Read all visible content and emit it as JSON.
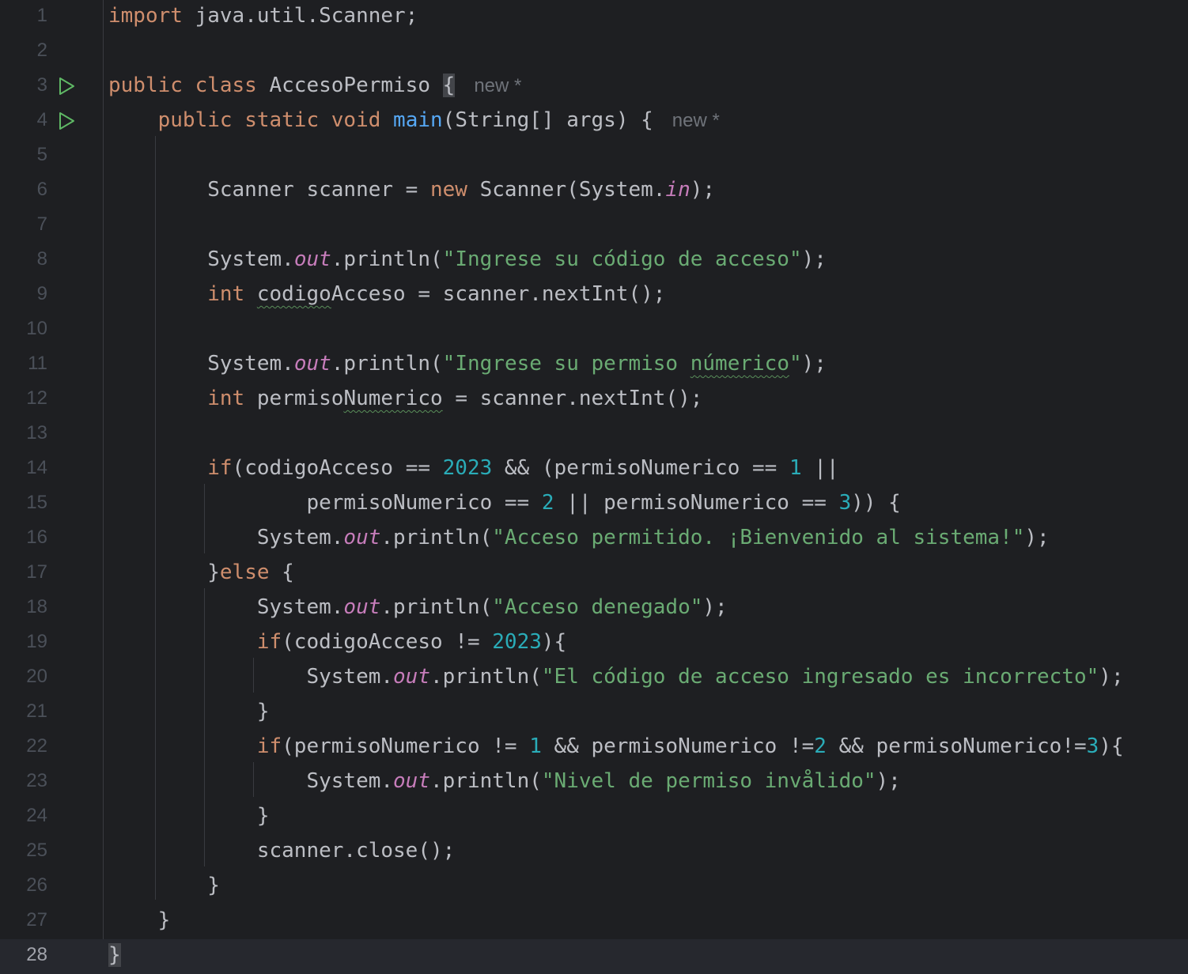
{
  "editor": {
    "current_line": 28,
    "inline_hint": "new *",
    "lines": [
      {
        "n": "1",
        "tokens": [
          {
            "t": "import",
            "c": "kw"
          },
          {
            "t": " java.util.Scanner;"
          }
        ]
      },
      {
        "n": "2",
        "tokens": []
      },
      {
        "n": "3",
        "run": true,
        "tokens": [
          {
            "t": "public class",
            "c": "kw"
          },
          {
            "t": " AccesoPermiso "
          },
          {
            "t": "{",
            "c": "brace-hl"
          }
        ],
        "hint": "new *"
      },
      {
        "n": "4",
        "run": true,
        "tokens": [
          {
            "t": "    "
          },
          {
            "t": "public static void",
            "c": "kw"
          },
          {
            "t": " "
          },
          {
            "t": "main",
            "c": "fn"
          },
          {
            "t": "(String[] args) {"
          }
        ],
        "hint": "new *"
      },
      {
        "n": "5",
        "tokens": []
      },
      {
        "n": "6",
        "tokens": [
          {
            "t": "        Scanner scanner = "
          },
          {
            "t": "new",
            "c": "kw"
          },
          {
            "t": " Scanner(System."
          },
          {
            "t": "in",
            "c": "st"
          },
          {
            "t": ");"
          }
        ]
      },
      {
        "n": "7",
        "tokens": []
      },
      {
        "n": "8",
        "tokens": [
          {
            "t": "        System."
          },
          {
            "t": "out",
            "c": "st"
          },
          {
            "t": ".println("
          },
          {
            "t": "\"Ingrese su código de acceso\"",
            "c": "str"
          },
          {
            "t": ");"
          }
        ]
      },
      {
        "n": "9",
        "tokens": [
          {
            "t": "        "
          },
          {
            "t": "int",
            "c": "kw"
          },
          {
            "t": " "
          },
          {
            "t": "codigo",
            "c": "wavy"
          },
          {
            "t": "Acceso = scanner.nextInt();"
          }
        ]
      },
      {
        "n": "10",
        "tokens": []
      },
      {
        "n": "11",
        "tokens": [
          {
            "t": "        System."
          },
          {
            "t": "out",
            "c": "st"
          },
          {
            "t": ".println("
          },
          {
            "t": "\"Ingrese su permiso ",
            "c": "str"
          },
          {
            "t": "númerico",
            "c": "str wavy"
          },
          {
            "t": "\"",
            "c": "str"
          },
          {
            "t": ");"
          }
        ]
      },
      {
        "n": "12",
        "tokens": [
          {
            "t": "        "
          },
          {
            "t": "int",
            "c": "kw"
          },
          {
            "t": " permiso"
          },
          {
            "t": "Numerico",
            "c": "wavy"
          },
          {
            "t": " = scanner.nextInt();"
          }
        ]
      },
      {
        "n": "13",
        "tokens": []
      },
      {
        "n": "14",
        "tokens": [
          {
            "t": "        "
          },
          {
            "t": "if",
            "c": "kw"
          },
          {
            "t": "(codigoAcceso == "
          },
          {
            "t": "2023",
            "c": "num"
          },
          {
            "t": " && (permisoNumerico == "
          },
          {
            "t": "1",
            "c": "num"
          },
          {
            "t": " ||"
          }
        ]
      },
      {
        "n": "15",
        "tokens": [
          {
            "t": "                permisoNumerico == "
          },
          {
            "t": "2",
            "c": "num"
          },
          {
            "t": " || permisoNumerico == "
          },
          {
            "t": "3",
            "c": "num"
          },
          {
            "t": ")) {"
          }
        ]
      },
      {
        "n": "16",
        "tokens": [
          {
            "t": "            System."
          },
          {
            "t": "out",
            "c": "st"
          },
          {
            "t": ".println("
          },
          {
            "t": "\"Acceso permitido. ¡Bienvenido al sistema!\"",
            "c": "str"
          },
          {
            "t": ");"
          }
        ]
      },
      {
        "n": "17",
        "tokens": [
          {
            "t": "        }"
          },
          {
            "t": "else",
            "c": "kw"
          },
          {
            "t": " {"
          }
        ]
      },
      {
        "n": "18",
        "tokens": [
          {
            "t": "            System."
          },
          {
            "t": "out",
            "c": "st"
          },
          {
            "t": ".println("
          },
          {
            "t": "\"Acceso denegado\"",
            "c": "str"
          },
          {
            "t": ");"
          }
        ]
      },
      {
        "n": "19",
        "tokens": [
          {
            "t": "            "
          },
          {
            "t": "if",
            "c": "kw"
          },
          {
            "t": "(codigoAcceso != "
          },
          {
            "t": "2023",
            "c": "num"
          },
          {
            "t": "){"
          }
        ]
      },
      {
        "n": "20",
        "tokens": [
          {
            "t": "                System."
          },
          {
            "t": "out",
            "c": "st"
          },
          {
            "t": ".println("
          },
          {
            "t": "\"El código de acceso ingresado es incorrecto\"",
            "c": "str"
          },
          {
            "t": ");"
          }
        ]
      },
      {
        "n": "21",
        "tokens": [
          {
            "t": "            }"
          }
        ]
      },
      {
        "n": "22",
        "tokens": [
          {
            "t": "            "
          },
          {
            "t": "if",
            "c": "kw"
          },
          {
            "t": "(permisoNumerico != "
          },
          {
            "t": "1",
            "c": "num"
          },
          {
            "t": " && permisoNumerico !="
          },
          {
            "t": "2",
            "c": "num"
          },
          {
            "t": " && permisoNumerico!="
          },
          {
            "t": "3",
            "c": "num"
          },
          {
            "t": "){"
          }
        ]
      },
      {
        "n": "23",
        "tokens": [
          {
            "t": "                System."
          },
          {
            "t": "out",
            "c": "st"
          },
          {
            "t": ".println("
          },
          {
            "t": "\"Nivel de permiso invålido\"",
            "c": "str"
          },
          {
            "t": ");"
          }
        ]
      },
      {
        "n": "24",
        "tokens": [
          {
            "t": "            }"
          }
        ]
      },
      {
        "n": "25",
        "tokens": [
          {
            "t": "            scanner.close();"
          }
        ]
      },
      {
        "n": "26",
        "tokens": [
          {
            "t": "        }"
          }
        ]
      },
      {
        "n": "27",
        "tokens": [
          {
            "t": "    }"
          }
        ]
      },
      {
        "n": "28",
        "tokens": [
          {
            "t": "}",
            "c": "brace-hl"
          }
        ]
      }
    ]
  },
  "colors": {
    "background": "#1e1f22",
    "keyword": "#cf8e6d",
    "string": "#6aab73",
    "number": "#2aacb8",
    "static_field": "#c77dbb",
    "method": "#56a8f5",
    "run_icon": "#5fb865"
  }
}
